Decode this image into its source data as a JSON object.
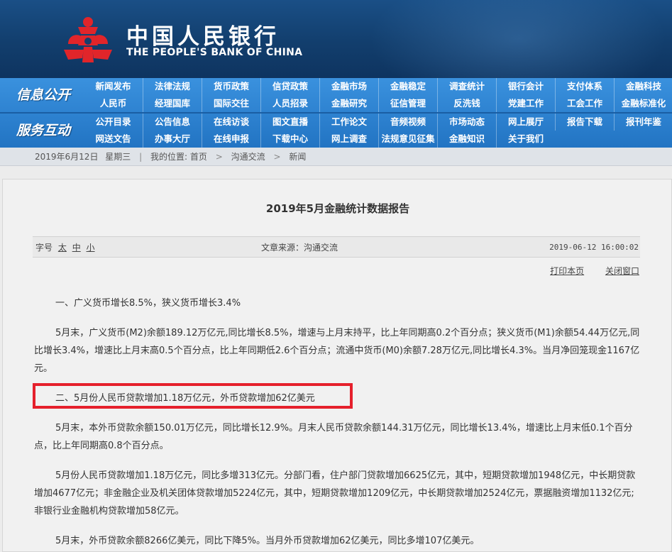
{
  "header": {
    "brand_cn": "中国人民银行",
    "brand_en": "THE PEOPLE'S BANK OF CHINA",
    "colors": {
      "bg": "#143f6e",
      "logo_red": "#e1252a"
    }
  },
  "nav": {
    "group1_label": "信息公开",
    "group2_label": "服务互动",
    "row1": [
      "新闻发布",
      "法律法规",
      "货币政策",
      "信贷政策",
      "金融市场",
      "金融稳定",
      "调查统计",
      "银行会计",
      "支付体系",
      "金融科技"
    ],
    "row2": [
      "人民币",
      "经理国库",
      "国际交往",
      "人员招录",
      "金融研究",
      "征信管理",
      "反洗钱",
      "党建工作",
      "工会工作",
      "金融标准化"
    ],
    "row3": [
      "公开目录",
      "公告信息",
      "在线访谈",
      "图文直播",
      "工作论文",
      "音频视频",
      "市场动态",
      "网上展厅",
      "报告下载",
      "报刊年鉴"
    ],
    "row4": [
      "网送文告",
      "办事大厅",
      "在线申报",
      "下载中心",
      "网上调查",
      "法规意见征集",
      "金融知识",
      "关于我们"
    ]
  },
  "breadcrumb": {
    "date": "2019年6月12日",
    "weekday": "星期三",
    "location_label": "我的位置:",
    "items": [
      "首页",
      "沟通交流",
      "新闻"
    ]
  },
  "article": {
    "title": "2019年5月金融统计数据报告",
    "font_size_label": "字号",
    "font_sizes": [
      "太",
      "中",
      "小"
    ],
    "source": "文章来源：沟通交流",
    "datetime": "2019-06-12 16:00:02",
    "print_label": "打印本页",
    "close_label": "关闭窗口",
    "paragraphs": [
      "一、广义货币增长8.5%，狭义货币增长3.4%",
      "5月末，广义货币(M2)余额189.12万亿元,同比增长8.5%，增速与上月末持平，比上年同期高0.2个百分点；狭义货币(M1)余额54.44万亿元,同比增长3.4%，增速比上月末高0.5个百分点，比上年同期低2.6个百分点；流通中货币(M0)余额7.28万亿元,同比增长4.3%。当月净回笼现金1167亿元。",
      "二、5月份人民币贷款增加1.18万亿元，外币贷款增加62亿美元",
      "5月末，本外币贷款余额150.01万亿元，同比增长12.9%。月末人民币贷款余额144.31万亿元，同比增长13.4%，增速比上月末低0.1个百分点，比上年同期高0.8个百分点。",
      "5月份人民币贷款增加1.18万亿元，同比多增313亿元。分部门看，住户部门贷款增加6625亿元，其中，短期贷款增加1948亿元，中长期贷款增加4677亿元；非金融企业及机关团体贷款增加5224亿元，其中，短期贷款增加1209亿元，中长期贷款增加2524亿元，票据融资增加1132亿元;非银行业金融机构贷款增加58亿元。",
      "5月末，外币贷款余额8266亿美元，同比下降5%。当月外币贷款增加62亿美元，同比多增107亿美元。"
    ],
    "highlight_color": "#e5202c"
  }
}
